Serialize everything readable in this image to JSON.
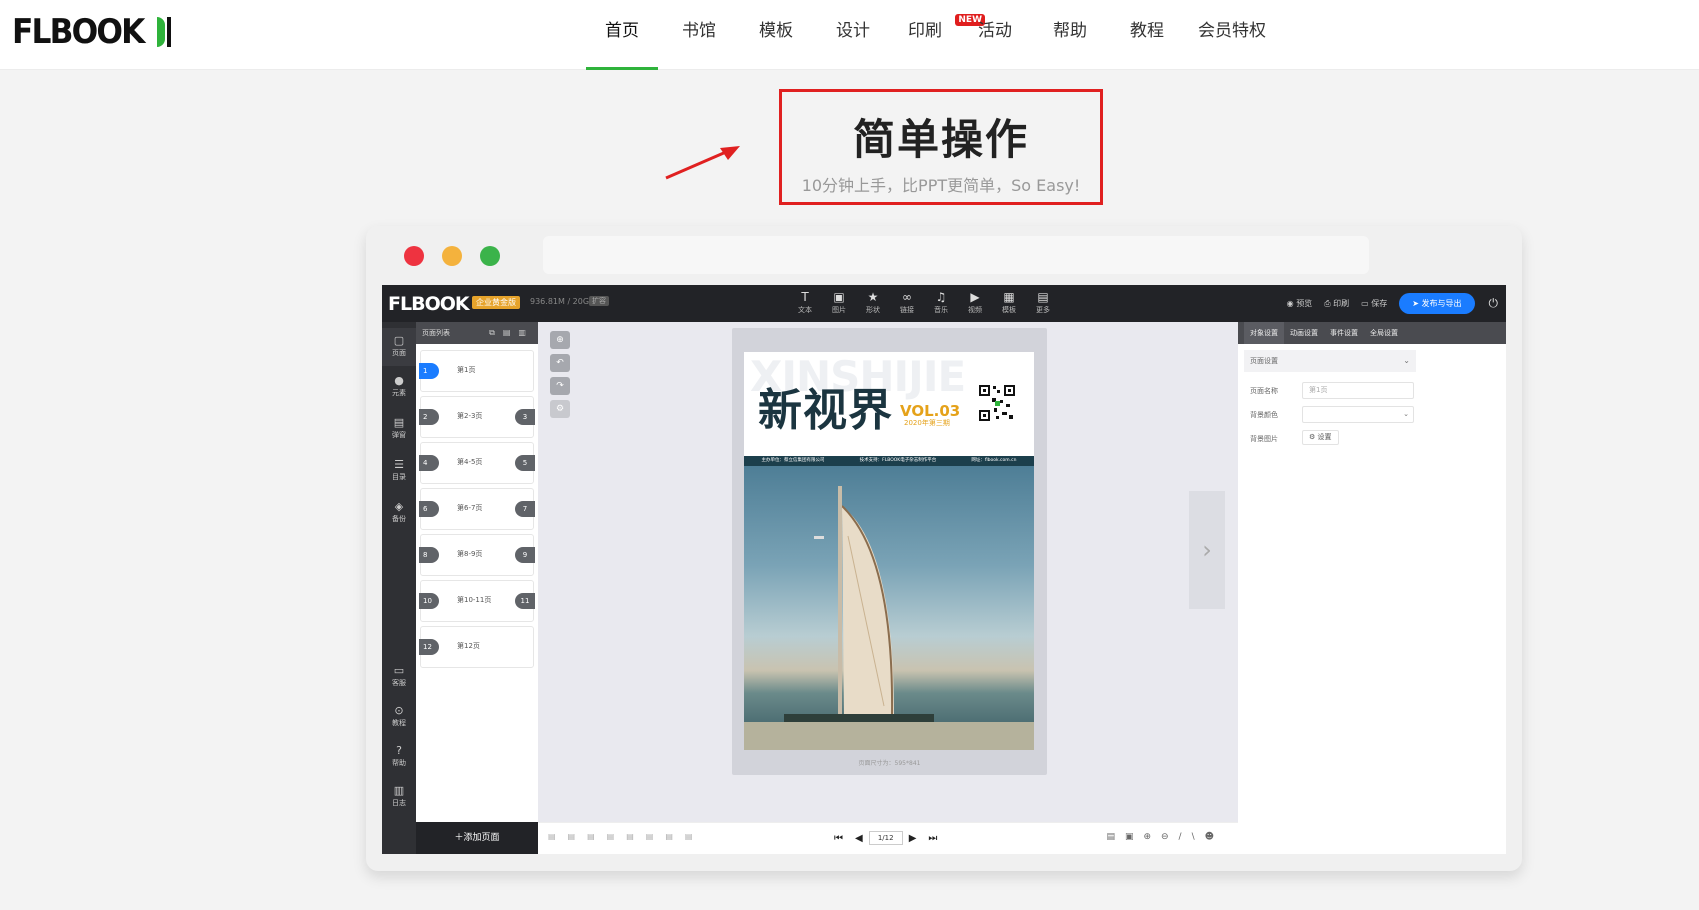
{
  "site": {
    "logo": "FLBOOK",
    "nav": [
      {
        "label": "首页",
        "active": true
      },
      {
        "label": "书馆"
      },
      {
        "label": "模板"
      },
      {
        "label": "设计"
      },
      {
        "label": "印刷",
        "badge": "NEW"
      },
      {
        "label": "活动"
      },
      {
        "label": "帮助"
      },
      {
        "label": "教程"
      },
      {
        "label": "会员特权"
      }
    ]
  },
  "hero": {
    "title": "简单操作",
    "subtitle": "10分钟上手，比PPT更简单，So Easy!"
  },
  "colors": {
    "accent_green": "#2fb33b",
    "highlight_red": "#e02020",
    "publish_blue": "#1a7cff"
  },
  "app": {
    "logo": "FLBOOK",
    "plan_badge": "企业黄金版",
    "storage": "936.81M / 20G",
    "storage_tag": "扩容",
    "tools": [
      {
        "icon": "text-icon",
        "label": "文本"
      },
      {
        "icon": "image-icon",
        "label": "图片"
      },
      {
        "icon": "star-icon",
        "label": "形状"
      },
      {
        "icon": "link-icon",
        "label": "链接"
      },
      {
        "icon": "music-icon",
        "label": "音乐"
      },
      {
        "icon": "video-icon",
        "label": "视频"
      },
      {
        "icon": "template-icon",
        "label": "模板"
      },
      {
        "icon": "more-icon",
        "label": "更多"
      }
    ],
    "actions": {
      "preview": "预览",
      "print": "印刷",
      "save": "保存",
      "publish": "发布与导出"
    },
    "leftbar": [
      {
        "icon": "page-icon",
        "label": "页面"
      },
      {
        "icon": "element-icon",
        "label": "元素"
      },
      {
        "icon": "popup-icon",
        "label": "弹窗"
      },
      {
        "icon": "toc-icon",
        "label": "目录"
      },
      {
        "icon": "backup-icon",
        "label": "备份"
      },
      {
        "icon": "service-icon",
        "label": "客服"
      },
      {
        "icon": "tutorial-icon",
        "label": "教程"
      },
      {
        "icon": "help-icon",
        "label": "帮助"
      },
      {
        "icon": "log-icon",
        "label": "日志"
      }
    ],
    "pages_panel": {
      "title": "页面列表",
      "pages": [
        {
          "left": "1",
          "label": "第1页",
          "right": ""
        },
        {
          "left": "2",
          "label": "第2-3页",
          "right": "3"
        },
        {
          "left": "4",
          "label": "第4-5页",
          "right": "5"
        },
        {
          "left": "6",
          "label": "第6-7页",
          "right": "7"
        },
        {
          "left": "8",
          "label": "第8-9页",
          "right": "9"
        },
        {
          "left": "10",
          "label": "第10-11页",
          "right": "11"
        },
        {
          "left": "12",
          "label": "第12页",
          "right": ""
        }
      ],
      "add_page": "添加页面"
    },
    "cover": {
      "bg_word": "XINSHIJIE",
      "title": "新视界",
      "vol": "VOL.03",
      "vol_sub": "2020年第三期",
      "strip": [
        "主办单位：蔡立信集团有限公司",
        "技术支持：FLBOOK电子杂志制作平台",
        "网址：flbook.com.cn"
      ],
      "size_label": "页面尺寸为：595*841"
    },
    "right_panel": {
      "tabs": [
        "对象设置",
        "动画设置",
        "事件设置",
        "全局设置"
      ],
      "section": "页面设置",
      "name_label": "页面名称",
      "name_value": "第1页",
      "bgcolor_label": "背景颜色",
      "bgimage_label": "背景图片",
      "bgimage_btn": "设置"
    },
    "bottom": {
      "pager": "1/12"
    }
  }
}
